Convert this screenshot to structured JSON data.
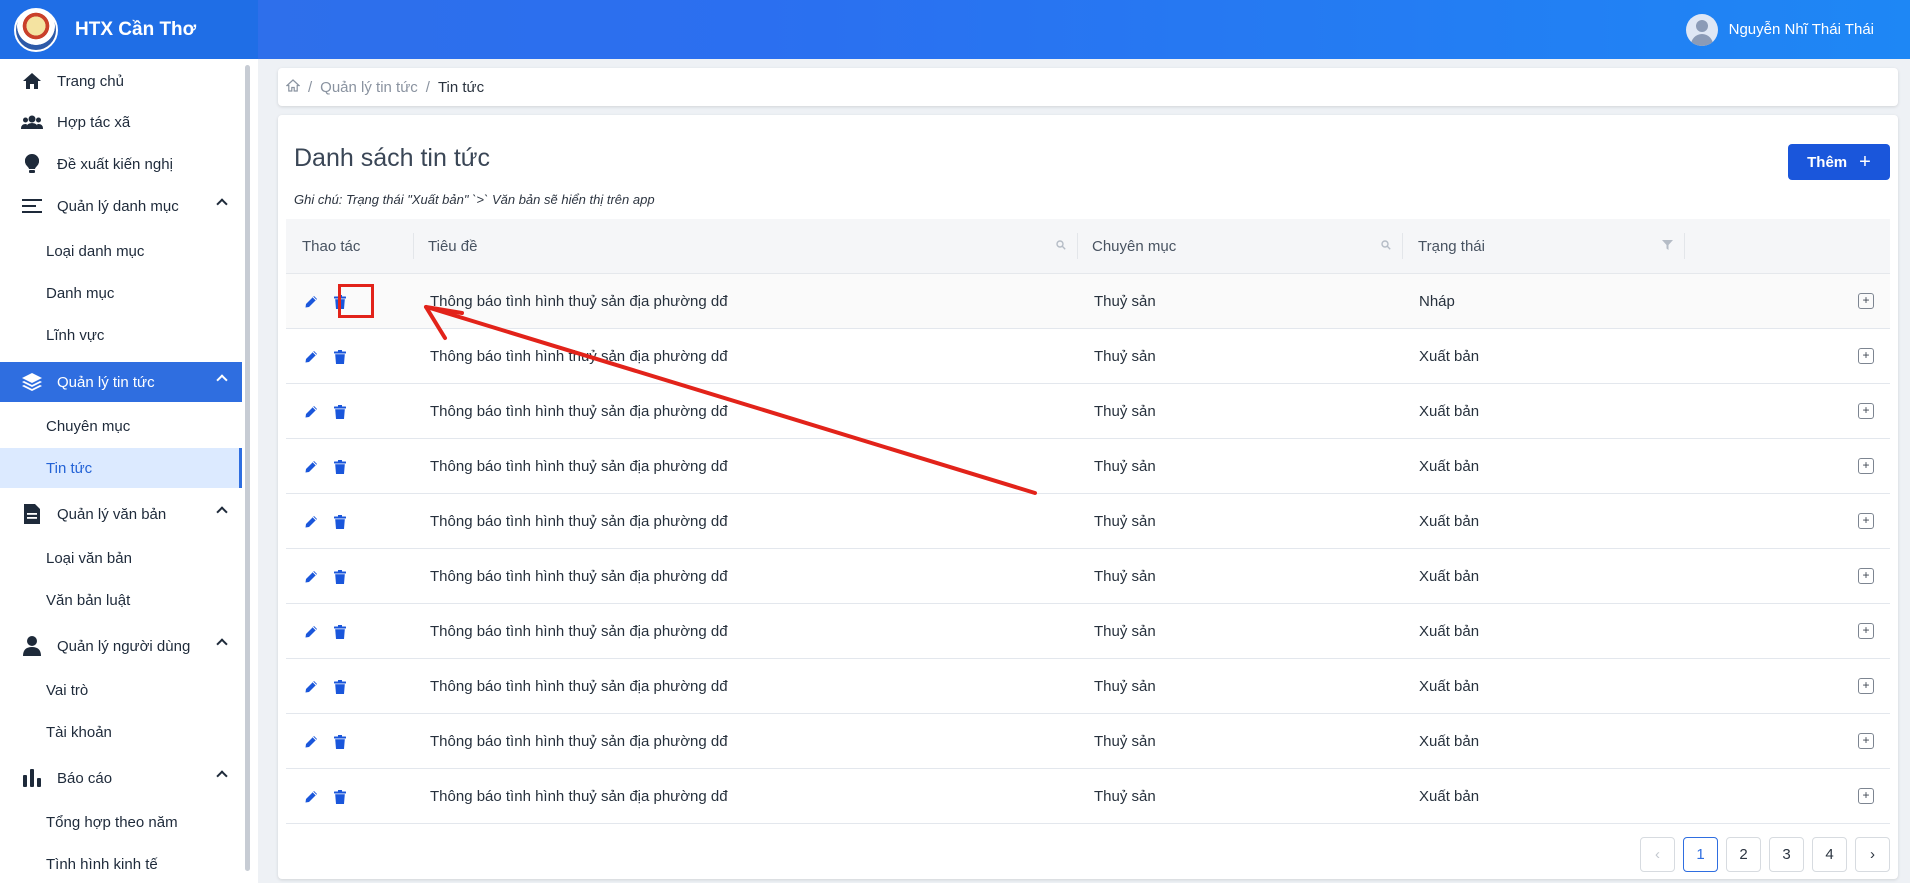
{
  "app": {
    "name": "HTX Cần Thơ",
    "user_name": "Nguyễn Nhĩ Thái Thái"
  },
  "sidebar": {
    "items": [
      {
        "label": "Trang chủ",
        "icon": "home-icon"
      },
      {
        "label": "Hợp tác xã",
        "icon": "users-icon"
      },
      {
        "label": "Đề xuất kiến nghị",
        "icon": "lightbulb-icon"
      },
      {
        "label": "Quản lý danh mục",
        "icon": "list-icon",
        "sub": [
          "Loại danh mục",
          "Danh mục",
          "Lĩnh vực"
        ]
      },
      {
        "label": "Quản lý tin tức",
        "icon": "layers-icon",
        "active": true,
        "sub": [
          "Chuyên mục",
          "Tin tức"
        ]
      },
      {
        "label": "Quản lý văn bản",
        "icon": "document-icon",
        "sub": [
          "Loại văn bản",
          "Văn bản luật"
        ]
      },
      {
        "label": "Quản lý người dùng",
        "icon": "user-icon",
        "sub": [
          "Vai trò",
          "Tài khoản"
        ]
      },
      {
        "label": "Báo cáo",
        "icon": "bar-chart-icon",
        "sub": [
          "Tổng hợp theo năm",
          "Tình hình kinh tế"
        ]
      }
    ]
  },
  "breadcrumb": {
    "parent": "Quản lý tin tức",
    "current": "Tin tức"
  },
  "main": {
    "title": "Danh sách tin tức",
    "note": "Ghi chú: Trạng thái \"Xuất bản\" `>` Văn bản sẽ hiển thị trên app",
    "add_label": "Thêm",
    "columns": [
      "Thao tác",
      "Tiêu đề",
      "Chuyên mục",
      "Trạng thái"
    ],
    "rows": [
      {
        "title": "Thông báo tình hình thuỷ sản địa phường dđ",
        "category": "Thuỷ sản",
        "status": "Nháp"
      },
      {
        "title": "Thông báo tình hình thuỷ sản địa phường dđ",
        "category": "Thuỷ sản",
        "status": "Xuất bản"
      },
      {
        "title": "Thông báo tình hình thuỷ sản địa phường dđ",
        "category": "Thuỷ sản",
        "status": "Xuất bản"
      },
      {
        "title": "Thông báo tình hình thuỷ sản địa phường dđ",
        "category": "Thuỷ sản",
        "status": "Xuất bản"
      },
      {
        "title": "Thông báo tình hình thuỷ sản địa phường dđ",
        "category": "Thuỷ sản",
        "status": "Xuất bản"
      },
      {
        "title": "Thông báo tình hình thuỷ sản địa phường dđ",
        "category": "Thuỷ sản",
        "status": "Xuất bản"
      },
      {
        "title": "Thông báo tình hình thuỷ sản địa phường dđ",
        "category": "Thuỷ sản",
        "status": "Xuất bản"
      },
      {
        "title": "Thông báo tình hình thuỷ sản địa phường dđ",
        "category": "Thuỷ sản",
        "status": "Xuất bản"
      },
      {
        "title": "Thông báo tình hình thuỷ sản địa phường dđ",
        "category": "Thuỷ sản",
        "status": "Xuất bản"
      },
      {
        "title": "Thông báo tình hình thuỷ sản địa phường dđ",
        "category": "Thuỷ sản",
        "status": "Xuất bản"
      }
    ],
    "pagination": {
      "pages": [
        "1",
        "2",
        "3",
        "4"
      ],
      "current": "1"
    }
  },
  "colors": {
    "accent": "#2f6ee0",
    "annotation": "#e2231a"
  }
}
